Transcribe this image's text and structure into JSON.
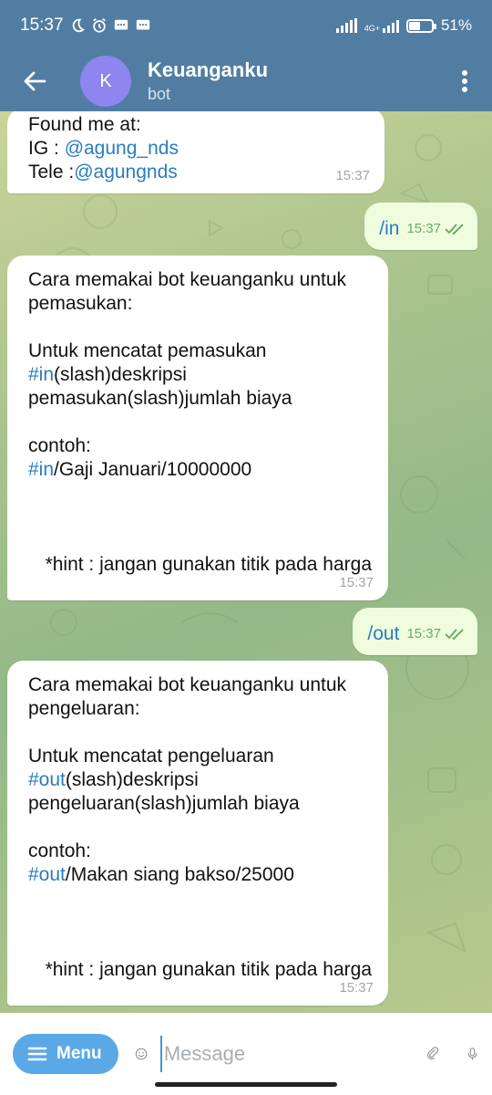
{
  "status_bar": {
    "time": "15:37",
    "network": "4G+",
    "battery": "51%",
    "battery_level": 0.51
  },
  "header": {
    "back_icon": "arrow-left-icon",
    "avatar_letter": "K",
    "avatar_color": "#8e85ee",
    "title": "Keuanganku",
    "subtitle": "bot",
    "menu_icon": "more-vertical-icon"
  },
  "messages": [
    {
      "direction": "in",
      "lines": [
        {
          "text": "Found me at:"
        },
        {
          "prefix": "IG : ",
          "link": "@agung_nds"
        },
        {
          "prefix": "Tele :",
          "link": "@agungnds"
        }
      ],
      "time": "15:37"
    },
    {
      "direction": "out",
      "text": "/in",
      "time": "15:37"
    },
    {
      "direction": "in",
      "lines": [
        {
          "text": "Cara memakai bot keuanganku untuk"
        },
        {
          "text": "pemasukan:"
        },
        {
          "text": ""
        },
        {
          "text": "Untuk mencatat pemasukan"
        },
        {
          "link": "#in",
          "suffix": "(slash)deskripsi"
        },
        {
          "text": "pemasukan(slash)jumlah biaya"
        },
        {
          "text": ""
        },
        {
          "text": "contoh:"
        },
        {
          "link": "#in",
          "suffix": "/Gaji Januari/10000000"
        }
      ],
      "hint": "*hint : jangan gunakan titik pada harga",
      "time": "15:37"
    },
    {
      "direction": "out",
      "text": "/out",
      "time": "15:37"
    },
    {
      "direction": "in",
      "lines": [
        {
          "text": "Cara memakai bot keuanganku untuk"
        },
        {
          "text": "pengeluaran:"
        },
        {
          "text": ""
        },
        {
          "text": "Untuk mencatat pengeluaran"
        },
        {
          "link": "#out",
          "suffix": "(slash)deskripsi"
        },
        {
          "text": "pengeluaran(slash)jumlah biaya"
        },
        {
          "text": ""
        },
        {
          "text": "contoh:"
        },
        {
          "link": "#out",
          "suffix": "/Makan siang bakso/25000"
        }
      ],
      "hint": "*hint : jangan gunakan titik pada harga",
      "time": "15:37"
    }
  ],
  "input_bar": {
    "menu_label": "Menu",
    "placeholder": "Message",
    "emoji_icon": "smiley-icon",
    "attach_icon": "paperclip-icon",
    "mic_icon": "microphone-icon"
  },
  "colors": {
    "header_bg": "#517da2",
    "link": "#2a7cbf",
    "outgoing_bubble": "#effdde",
    "menu_button": "#5aa9e6"
  }
}
